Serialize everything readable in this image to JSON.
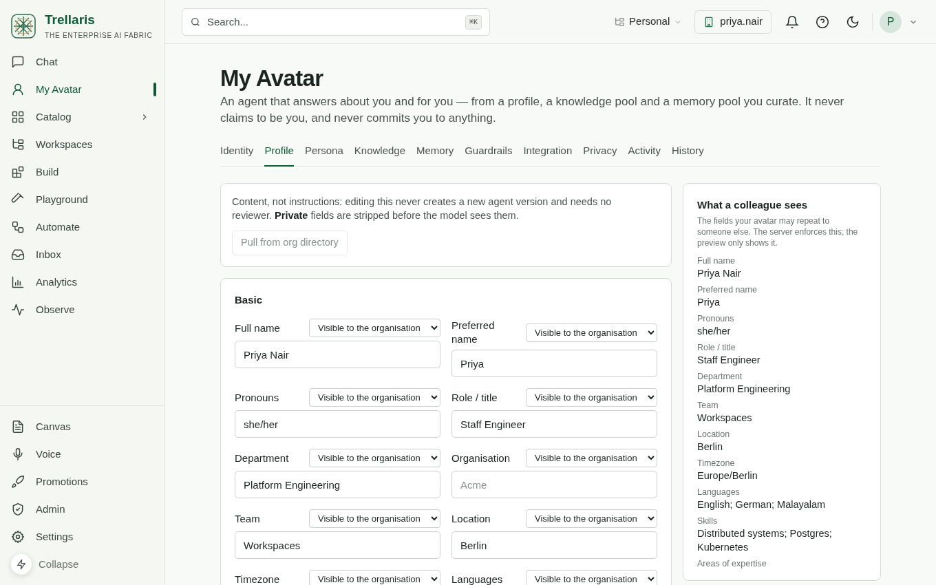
{
  "brand": {
    "name": "Trellaris",
    "tagline": "THE ENTERPRISE AI FABRIC"
  },
  "sidebar": {
    "items": [
      {
        "label": "Chat",
        "selected": false,
        "has_submenu": false
      },
      {
        "label": "My Avatar",
        "selected": true,
        "has_submenu": false
      },
      {
        "label": "Catalog",
        "selected": false,
        "has_submenu": true
      },
      {
        "label": "Workspaces",
        "selected": false,
        "has_submenu": false
      },
      {
        "label": "Build",
        "selected": false,
        "has_submenu": false
      },
      {
        "label": "Playground",
        "selected": false,
        "has_submenu": false
      },
      {
        "label": "Automate",
        "selected": false,
        "has_submenu": false
      },
      {
        "label": "Inbox",
        "selected": false,
        "has_submenu": false
      },
      {
        "label": "Analytics",
        "selected": false,
        "has_submenu": false
      },
      {
        "label": "Observe",
        "selected": false,
        "has_submenu": false
      }
    ],
    "bottom_items": [
      {
        "label": "Canvas",
        "selected": false
      },
      {
        "label": "Voice",
        "selected": false
      },
      {
        "label": "Promotions",
        "selected": false
      },
      {
        "label": "Admin",
        "selected": false
      },
      {
        "label": "Settings",
        "selected": false
      }
    ],
    "collapse": "Collapse"
  },
  "header": {
    "search": {
      "placeholder": "Search...",
      "shortcut": "⌘K"
    },
    "workspace": "Personal",
    "org": "priya.nair",
    "avatar": "P"
  },
  "page": {
    "title": "My Avatar",
    "description": "An agent that answers about you and for you — from a profile, a knowledge pool and a memory pool you curate. It never claims to be you, and never commits you to anything."
  },
  "tabs": [
    {
      "label": "Identity",
      "selected": false
    },
    {
      "label": "Profile",
      "selected": true
    },
    {
      "label": "Persona",
      "selected": false
    },
    {
      "label": "Knowledge",
      "selected": false
    },
    {
      "label": "Memory",
      "selected": false
    },
    {
      "label": "Guardrails",
      "selected": false
    },
    {
      "label": "Integration",
      "selected": false
    },
    {
      "label": "Privacy",
      "selected": false
    },
    {
      "label": "Activity",
      "selected": false
    },
    {
      "label": "History",
      "selected": false
    }
  ],
  "notice": {
    "text": "Content, not instructions: editing this never creates a new agent version and needs no reviewer. **Private** fields are stripped before the model sees them.",
    "button": "Pull from org directory"
  },
  "basic": {
    "title": "Basic",
    "fields": [
      {
        "label": "Full name",
        "visibility": "Visible to the organisation",
        "value": "Priya Nair"
      },
      {
        "label": "Preferred name",
        "visibility": "Visible to the organisation",
        "value": "Priya"
      },
      {
        "label": "Pronouns",
        "visibility": "Visible to the organisation",
        "value": "she/her"
      },
      {
        "label": "Role / title",
        "visibility": "Visible to the organisation",
        "value": "Staff Engineer"
      },
      {
        "label": "Department",
        "visibility": "Visible to the organisation",
        "value": "Platform Engineering"
      },
      {
        "label": "Organisation",
        "visibility": "Visible to the organisation",
        "placeholder": "Acme"
      },
      {
        "label": "Team",
        "visibility": "Visible to the organisation",
        "value": "Workspaces"
      },
      {
        "label": "Location",
        "visibility": "Visible to the organisation",
        "value": "Berlin"
      },
      {
        "label": "Timezone",
        "visibility": "Visible to the organisation"
      },
      {
        "label": "Languages",
        "visibility": "Visible to the organisation"
      }
    ]
  },
  "preview": {
    "title": "What a colleague sees",
    "description": "The fields your avatar may repeat to someone else. The server enforces this; the preview only shows it.",
    "entries": [
      {
        "label": "Full name",
        "value": "Priya Nair"
      },
      {
        "label": "Preferred name",
        "value": "Priya"
      },
      {
        "label": "Pronouns",
        "value": "she/her"
      },
      {
        "label": "Role / title",
        "value": "Staff Engineer"
      },
      {
        "label": "Department",
        "value": "Platform Engineering"
      },
      {
        "label": "Team",
        "value": "Workspaces"
      },
      {
        "label": "Location",
        "value": "Berlin"
      },
      {
        "label": "Timezone",
        "value": "Europe/Berlin"
      },
      {
        "label": "Languages",
        "value": "English; German; Malayalam"
      },
      {
        "label": "Skills",
        "value": "Distributed systems; Postgres; Kubernetes"
      },
      {
        "label": "Areas of expertise"
      }
    ]
  }
}
